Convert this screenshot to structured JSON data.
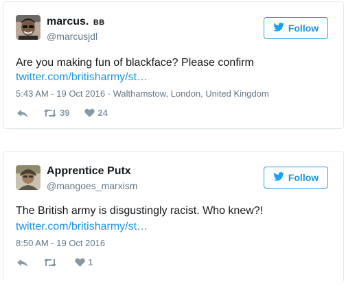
{
  "tweets": [
    {
      "author": {
        "name": "marcus.",
        "badge": "BB",
        "handle": "@marcusjdl"
      },
      "follow_label": "Follow",
      "text": "Are you making fun of blackface? Please confirm",
      "link": "twitter.com/britisharmy/st…",
      "meta": "5:43 AM - 19 Oct 2016 · Walthamstow, London, United Kingdom",
      "retweets": "39",
      "likes": "24"
    },
    {
      "author": {
        "name": "Apprentice Putx",
        "handle": "@mangoes_marxism"
      },
      "follow_label": "Follow",
      "text": "The British army is disgustingly racist. Who knew?!",
      "link": "twitter.com/britisharmy/st…",
      "meta": "8:50 AM - 19 Oct 2016",
      "retweets": "",
      "likes": "1"
    }
  ],
  "colors": {
    "accent": "#1da1f2",
    "link": "#1b95e0",
    "muted": "#657786",
    "icon": "#8899a6"
  },
  "icons": [
    "reply-icon",
    "retweet-icon",
    "like-icon",
    "twitter-bird-icon"
  ]
}
